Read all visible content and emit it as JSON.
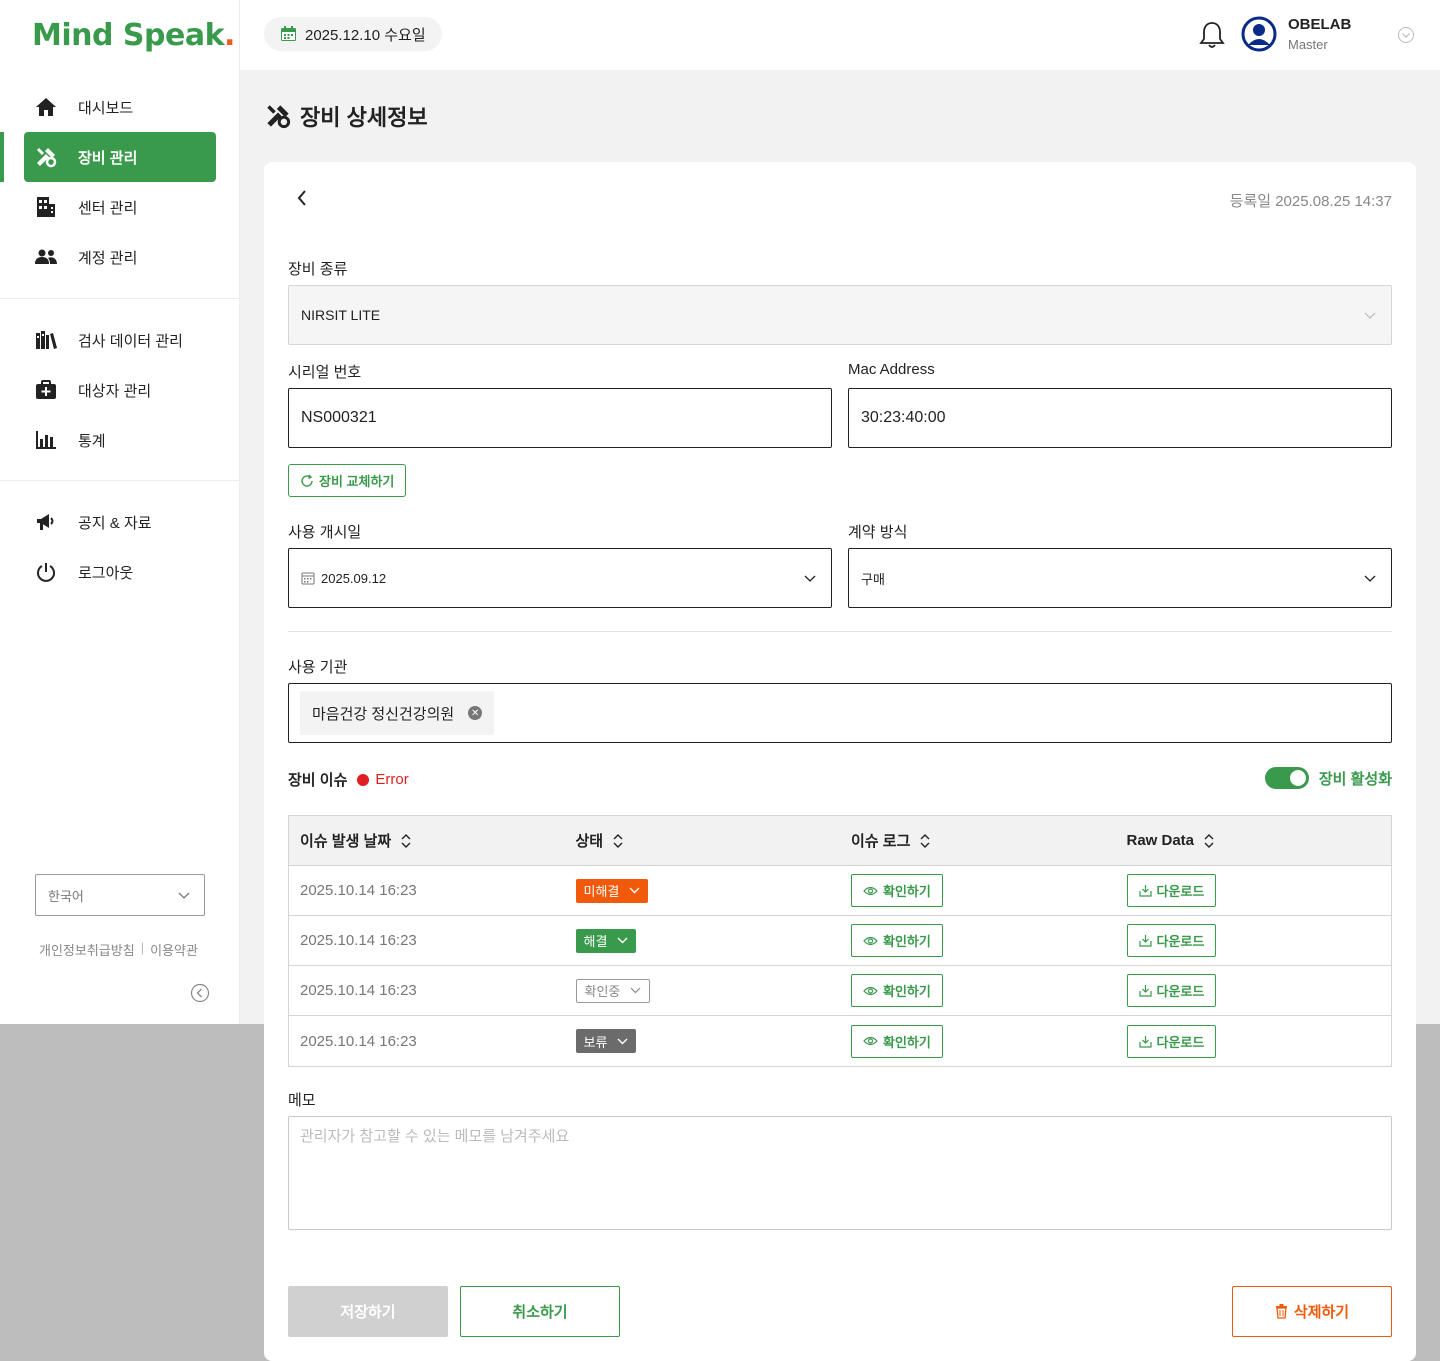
{
  "brand": {
    "logo_text": "Mind Speak",
    "logo_dot": "."
  },
  "sidebar": {
    "group1": [
      {
        "label": "대시보드",
        "icon": "home-icon"
      },
      {
        "label": "장비 관리",
        "icon": "tools-icon",
        "active": true
      },
      {
        "label": "센터 관리",
        "icon": "building-icon"
      },
      {
        "label": "계정 관리",
        "icon": "users-icon"
      }
    ],
    "group2": [
      {
        "label": "검사 데이터 관리",
        "icon": "books-icon"
      },
      {
        "label": "대상자 관리",
        "icon": "medical-bag-icon"
      },
      {
        "label": "통계",
        "icon": "bar-chart-icon"
      }
    ],
    "group3": [
      {
        "label": "공지 & 자료",
        "icon": "megaphone-icon"
      },
      {
        "label": "로그아웃",
        "icon": "power-icon"
      }
    ],
    "language": "한국어",
    "privacy_link": "개인정보취급방침",
    "terms_link": "이용약관"
  },
  "header": {
    "date": "2025.12.10 수요일",
    "user_name": "OBELAB",
    "user_role": "Master"
  },
  "page": {
    "title": "장비 상세정보",
    "reg_date": "등록일 2025.08.25 14:37"
  },
  "form": {
    "device_type_label": "장비 종류",
    "device_type_value": "NIRSIT LITE",
    "serial_label": "시리얼 번호",
    "serial_value": "NS000321",
    "mac_label": "Mac Address",
    "mac_value": "30:23:40:00",
    "swap_button": "장비 교체하기",
    "start_date_label": "사용 개시일",
    "start_date_value": "2025.09.12",
    "contract_label": "계약 방식",
    "contract_value": "구매",
    "org_label": "사용 기관",
    "org_tag": "마음건강 정신건강의원"
  },
  "issues": {
    "title": "장비 이슈",
    "status": "Error",
    "toggle_label": "장비 활성화",
    "toggle_on": true,
    "columns": [
      "이슈 발생 날짜",
      "상태",
      "이슈 로그",
      "Raw Data"
    ],
    "rows": [
      {
        "date": "2025.10.14 16:23",
        "status": "미해결",
        "status_style": "orange",
        "log_button": "확인하기",
        "raw_button": "다운로드"
      },
      {
        "date": "2025.10.14 16:23",
        "status": "해결",
        "status_style": "green",
        "log_button": "확인하기",
        "raw_button": "다운로드"
      },
      {
        "date": "2025.10.14 16:23",
        "status": "확인중",
        "status_style": "gray-outline",
        "log_button": "확인하기",
        "raw_button": "다운로드"
      },
      {
        "date": "2025.10.14 16:23",
        "status": "보류",
        "status_style": "gray",
        "log_button": "확인하기",
        "raw_button": "다운로드"
      }
    ]
  },
  "memo": {
    "label": "메모",
    "placeholder": "관리자가 참고할 수 있는 메모를 남겨주세요"
  },
  "actions": {
    "save": "저장하기",
    "cancel": "취소하기",
    "delete": "삭제하기"
  },
  "colors": {
    "brand_green": "#3a9a4c",
    "alert_orange": "#f05a0a",
    "error_red": "#e02020"
  }
}
